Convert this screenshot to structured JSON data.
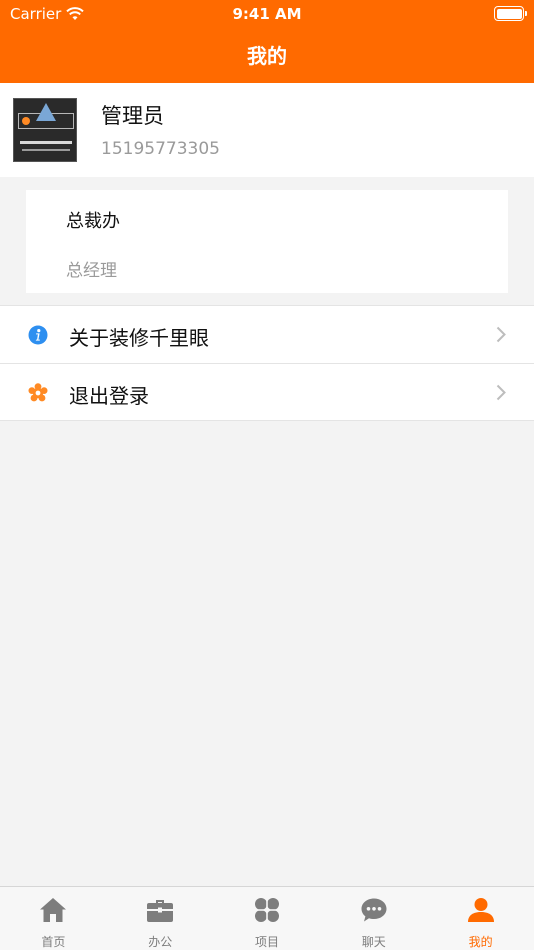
{
  "status_bar": {
    "carrier": "Carrier",
    "time": "9:41 AM"
  },
  "nav": {
    "title": "我的"
  },
  "profile": {
    "name": "管理员",
    "phone": "15195773305"
  },
  "org": {
    "department": "总裁办",
    "position": "总经理"
  },
  "menu": [
    {
      "label": "关于装修千里眼",
      "icon": "info-icon"
    },
    {
      "label": "退出登录",
      "icon": "gear-icon"
    }
  ],
  "tabs": [
    {
      "label": "首页",
      "icon": "home-icon"
    },
    {
      "label": "办公",
      "icon": "briefcase-icon"
    },
    {
      "label": "项目",
      "icon": "grid-petal-icon"
    },
    {
      "label": "聊天",
      "icon": "chat-bubble-icon"
    },
    {
      "label": "我的",
      "icon": "person-icon",
      "active": true
    }
  ],
  "colors": {
    "accent": "#ff6a00",
    "tab_inactive": "#7d7d7d",
    "info_blue": "#2e8ff0",
    "gear_orange": "#ff8a24"
  }
}
